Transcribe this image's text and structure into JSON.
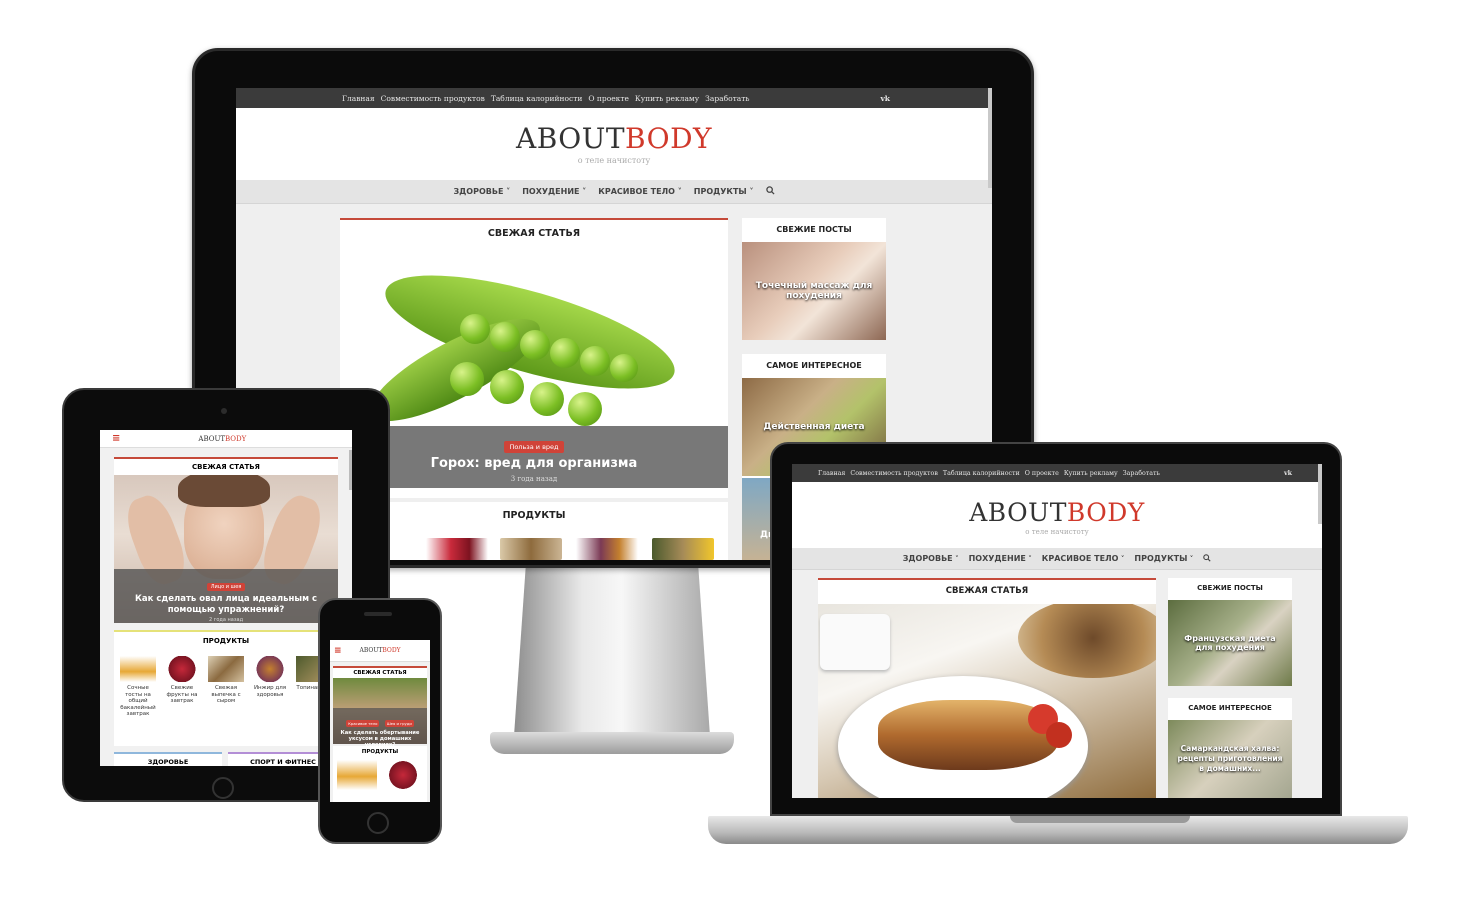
{
  "site": {
    "logo_part1": "ABOUT",
    "logo_part2": "BODY",
    "tagline": "о теле начистоту"
  },
  "topbar": {
    "links": [
      "Главная",
      "Совместимость продуктов",
      "Таблица калорийности",
      "О проекте",
      "Купить рекламу",
      "Заработать"
    ],
    "social": "vk"
  },
  "menu": {
    "items": [
      "ЗДОРОВЬЕ",
      "ПОХУДЕНИЕ",
      "КРАСИВОЕ ТЕЛО",
      "ПРОДУКТЫ"
    ],
    "search_icon": "search-icon"
  },
  "desktop": {
    "fresh_title": "СВЕЖАЯ СТАТЬЯ",
    "article_badge": "Польза и вред",
    "article_title": "Горох: вред для организма",
    "article_date": "3 года назад",
    "products_title": "ПРОДУКТЫ",
    "sidebar_recent": "СВЕЖИЕ ПОСТЫ",
    "sidebar_recent_post": "Точечный массаж для похудения",
    "sidebar_popular": "САМОЕ ИНТЕРЕСНОЕ",
    "sidebar_popular_post": "Действенная диета",
    "sidebar_popular_post2": "Ди"
  },
  "laptop": {
    "fresh_title": "СВЕЖАЯ СТАТЬЯ",
    "sidebar_recent": "СВЕЖИЕ ПОСТЫ",
    "sidebar_recent_post": "Французская диета для похудения",
    "sidebar_popular": "САМОЕ ИНТЕРЕСНОЕ",
    "sidebar_popular_post": "Самаркандская халва: рецепты приготовления в домашних..."
  },
  "tablet": {
    "fresh_title": "СВЕЖАЯ СТАТЬЯ",
    "article_badge": "Лицо и шея",
    "article_title": "Как сделать овал лица идеальным с помощью упражнений?",
    "article_date": "2 года назад",
    "products_title": "ПРОДУКТЫ",
    "products": [
      "Сочные тосты на общий бакалейный завтрак",
      "Свежие фрукты на завтрак",
      "Свежая выпечка с сыром",
      "Инжир для здоровья",
      "Топинамбур"
    ],
    "section_health": "ЗДОРОВЬЕ",
    "section_sport": "СПОРТ И ФИТНЕС"
  },
  "phone": {
    "fresh_title": "СВЕЖАЯ СТАТЬЯ",
    "badge1": "Красивое тело",
    "badge2": "Шея и груди",
    "article_title": "Как сделать обертывание уксусом в домашних условиях?",
    "products_title": "ПРОДУКТЫ"
  },
  "colors": {
    "accent": "#d0392b",
    "topbar_bg": "#3b3b3b",
    "menu_bg": "#e4e4e4"
  }
}
